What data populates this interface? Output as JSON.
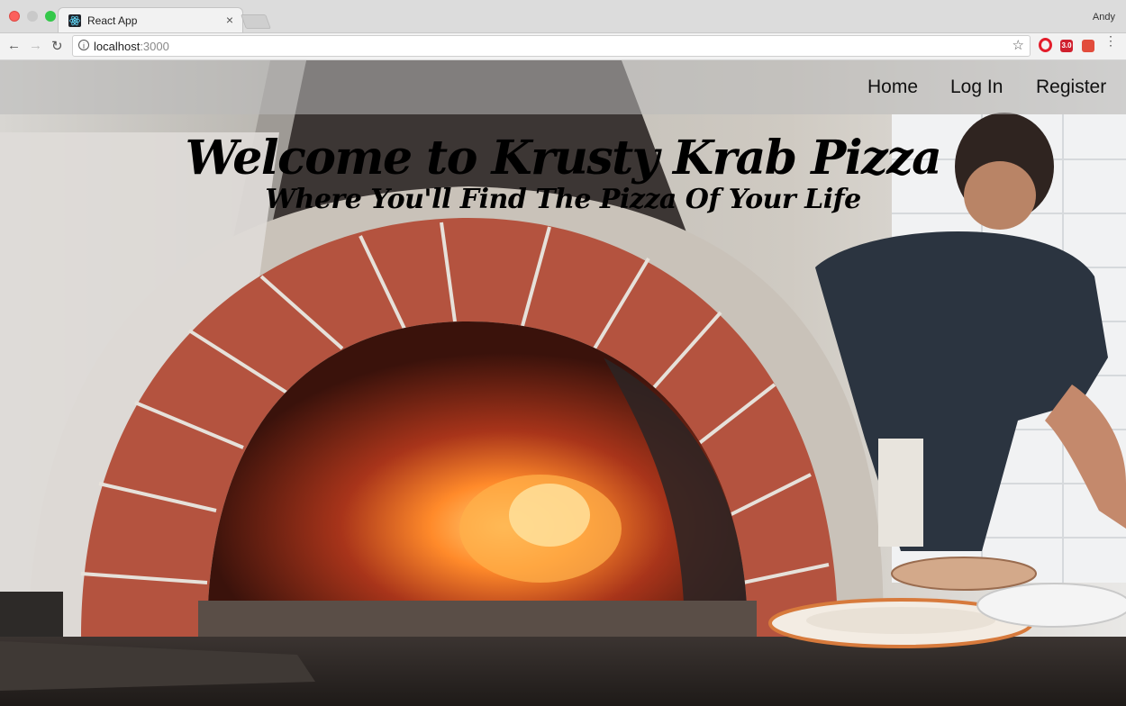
{
  "browser": {
    "tab_title": "React App",
    "tab_close": "×",
    "profile_name": "Andy",
    "url_host": "localhost",
    "url_port": ":3000",
    "extension_badge": "3.0",
    "icons": [
      "react-favicon",
      "back-arrow-icon",
      "forward-arrow-icon",
      "reload-icon",
      "info-icon",
      "star-icon",
      "opera-icon",
      "extension-badge-icon",
      "extension-icon",
      "menu-dots-icon"
    ]
  },
  "nav": {
    "home": "Home",
    "login": "Log In",
    "register": "Register"
  },
  "hero": {
    "title": "Welcome to Krusty Krab Pizza",
    "subtitle": "Where You'll Find The Pizza Of Your Life",
    "background": "pizza oven photo"
  }
}
